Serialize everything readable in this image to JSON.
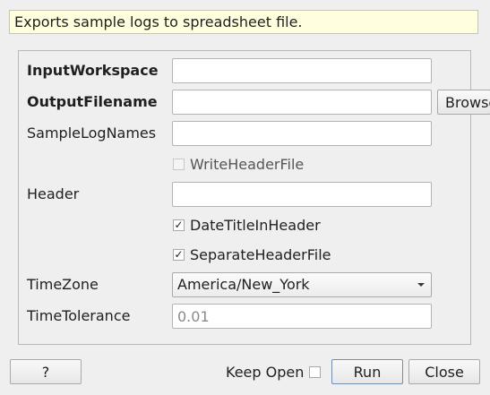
{
  "description": "Exports sample logs to spreadsheet file.",
  "properties": {
    "input_workspace": {
      "label": "InputWorkspace",
      "value": ""
    },
    "output_filename": {
      "label": "OutputFilename",
      "value": "",
      "browse_label": "Browse"
    },
    "sample_log_names": {
      "label": "SampleLogNames",
      "value": ""
    },
    "write_header_file": {
      "label": "WriteHeaderFile",
      "checked": false,
      "enabled": false
    },
    "header": {
      "label": "Header",
      "value": ""
    },
    "date_title_in_header": {
      "label": "DateTitleInHeader",
      "checked": true
    },
    "separate_header_file": {
      "label": "SeparateHeaderFile",
      "checked": true
    },
    "time_zone": {
      "label": "TimeZone",
      "selected": "America/New_York"
    },
    "time_tolerance": {
      "label": "TimeTolerance",
      "placeholder": "0.01"
    }
  },
  "footer": {
    "help_label": "?",
    "keep_open_label": "Keep Open",
    "keep_open_checked": false,
    "run_label": "Run",
    "close_label": "Close"
  }
}
